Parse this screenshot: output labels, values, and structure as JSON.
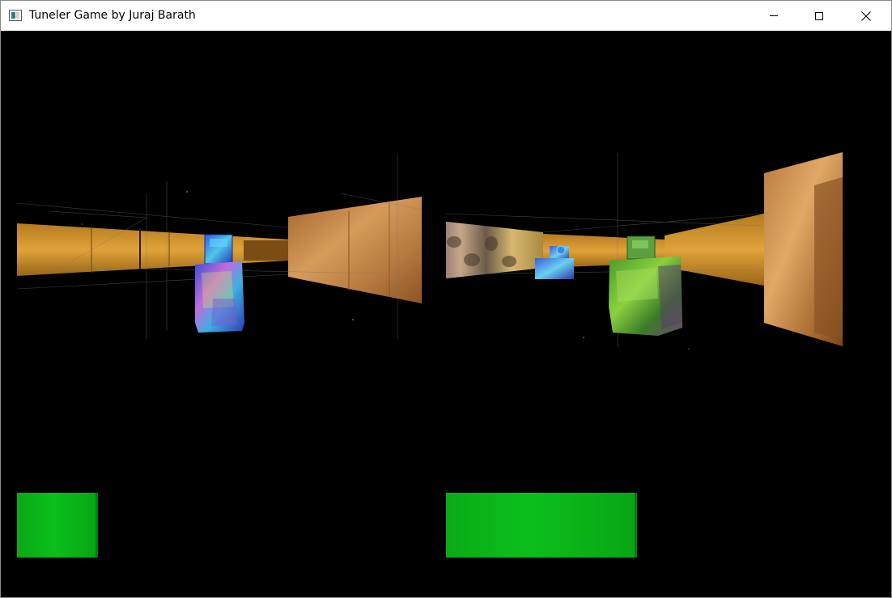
{
  "window": {
    "title": "Tuneler Game by Juraj Barath",
    "controls": {
      "minimize_icon": "minimize-icon",
      "maximize_icon": "maximize-icon",
      "close_icon": "close-icon"
    }
  },
  "players": [
    {
      "view": "left",
      "energy_fraction": 0.2,
      "energy_color": "#0bbf1b"
    },
    {
      "view": "right",
      "energy_fraction": 0.49,
      "energy_color": "#0bbf1b"
    }
  ]
}
